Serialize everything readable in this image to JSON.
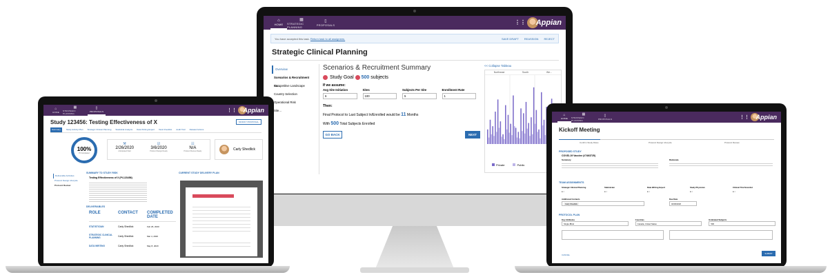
{
  "brand": {
    "logo": "Appian",
    "accent": "#2b6cb0",
    "nav_color": "#4a2a5e",
    "bar_color": "#7b6bc9"
  },
  "monitor": {
    "nav": {
      "tabs": [
        "HOME",
        "STRATEGIC PLANNING",
        "PROPOSALS"
      ]
    },
    "banner": {
      "text": "You have accepted this task.",
      "link": "Return task to all assignees.",
      "actions": [
        "SAVE DRAFT",
        "REASSIGN",
        "REJECT"
      ]
    },
    "page_title": "Strategic Clinical Planning",
    "steps": [
      "Overview",
      "Scenarios & Recruitment Su...",
      "Competitive Landscape",
      "Country Selection",
      "Operational Risk",
      "Site..."
    ],
    "section_title": "Scenarios & Recruitment Summary",
    "goal": {
      "prefix": "Study Goal",
      "value": "500",
      "suffix": "subjects"
    },
    "assume": "If we assume:",
    "fields": [
      {
        "label": "Avg Site Initiation",
        "value": "6"
      },
      {
        "label": "Sites",
        "value": "100"
      },
      {
        "label": "Subjects Per Site",
        "value": "5"
      },
      {
        "label": "Enrollment Rate",
        "value": "1"
      }
    ],
    "then": "Then:",
    "result1": {
      "pre": "Final Protocol to Last Subject In/Enrolled would be",
      "value": "11",
      "post": "Months"
    },
    "result2": {
      "pre": "With",
      "value": "500",
      "post": "Total Subjects Enrolled"
    },
    "back": "GO BACK",
    "next": "NEXT",
    "collapse": "<< Collapse Tableau",
    "chart_cols": [
      "Northeast",
      "South",
      "We..."
    ],
    "legend": [
      "Private",
      "Public"
    ]
  },
  "laptop_left": {
    "nav": {
      "tabs": [
        "HOME",
        "STRATEGIC PLANNING",
        "PROPOSALS"
      ]
    },
    "title": "Study 123456: Testing Effectiveness of X",
    "modify": "MODIFY PROPOSAL",
    "tabs": [
      "Summary",
      "Study Activity Plan",
      "Strategic Clinical Planning",
      "Statistical Analysis",
      "Data Writing Expert",
      "Task Checklist",
      "Audit Trail",
      "Related Actions"
    ],
    "progress": "100%",
    "progress_label": "PI Completed",
    "stats": [
      {
        "value": "2/26/2020",
        "label": "Anticipated Start"
      },
      {
        "value": "3/6/2020",
        "label": "Protocol Design Ready"
      },
      {
        "value": "N/A",
        "label": "Protocol Review Ready"
      }
    ],
    "person": "Carly Shedlick",
    "menu": [
      "Deliverable Activities",
      "Protocol Design Lifecycle",
      "Protocol Review"
    ],
    "summary_head": "SUMMARY TO STUDY RISK",
    "summary_title": "Testing Effectiveness of X (PI-123456)",
    "deliverables_head": "DELIVERABLES",
    "plan_head": "CURRENT STUDY DELIVERY PLAN",
    "table_headers": [
      "ROLE",
      "CONTACT",
      "COMPLETED DATE"
    ],
    "rows": [
      {
        "role": "STATISTICIAN",
        "contact": "Carly Shedlick",
        "date": "Feb 26, 2020"
      },
      {
        "role": "STRATEGIC CLINICAL PLANNING",
        "contact": "Carly Shedlick",
        "date": "Mar 4, 2020"
      },
      {
        "role": "DATA WRITING",
        "contact": "Carly Shedlick",
        "date": "May 8, 2020"
      }
    ]
  },
  "laptop_right": {
    "nav": {
      "tabs": [
        "HOME",
        "STRATEGIC PLANNING",
        "PROPOSALS"
      ]
    },
    "title": "Kickoff Meeting",
    "steps": [
      "Confirm Study Roles",
      "Protocol Design Lifecycle",
      "Protocol Review"
    ],
    "s1": "PROPOSED STUDY",
    "study_name": "COVID-19 Vaccine (#7463725)",
    "summary_label": "Summary",
    "rationale_label": "Rationale",
    "s2": "TEAM ASSIGNMENTS",
    "roles": [
      "Strategic Clinical Planning",
      "Statistician",
      "Data Writing Expert",
      "Study Physician",
      "Clinical Trial Scientist"
    ],
    "contact_label": "Additional Contacts",
    "contact": "Carly Shedlick",
    "due_label": "Due Date",
    "due": "04/06/2020",
    "s3": "PROTOCOL PLAN",
    "plan_fields": [
      "Key Attributes",
      "Countries",
      "Estimated Subjects"
    ],
    "plan_values": [
      "Single-Blind",
      "Canada, United States",
      "500"
    ],
    "cancel": "CANCEL",
    "submit": "SUBMIT"
  },
  "chart_data": {
    "type": "bar",
    "categories": [
      "Northeast",
      "South",
      "We..."
    ],
    "series": [
      {
        "name": "Private",
        "values": [
          18,
          30,
          22,
          40,
          55,
          28,
          12,
          48,
          36,
          25,
          60,
          20,
          15,
          44,
          38,
          52,
          26,
          33,
          70,
          42,
          18,
          64,
          30,
          46,
          22,
          56,
          35,
          40
        ]
      },
      {
        "name": "Public",
        "values": [
          8,
          12,
          10,
          15,
          20,
          9,
          6,
          18,
          14,
          11,
          22,
          8,
          7,
          16,
          13,
          19,
          10,
          12,
          25,
          15,
          7,
          23,
          11,
          17,
          9,
          21,
          13,
          15
        ]
      }
    ]
  }
}
